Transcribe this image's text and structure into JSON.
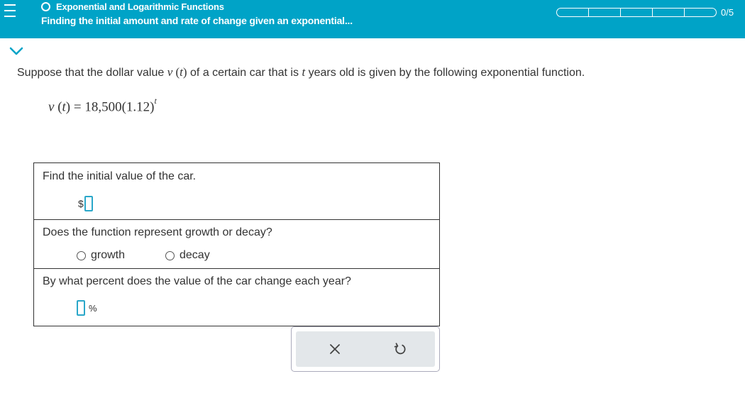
{
  "header": {
    "topic": "Exponential and Logarithmic Functions",
    "subtitle": "Finding the initial amount and rate of change given an exponential...",
    "progress": {
      "completed": 0,
      "total": 5,
      "label": "0/5"
    },
    "icons": {
      "menu": "hamburger-menu-icon",
      "topic_status": "hollow-circle-icon",
      "collapse": "chevron-down-icon"
    }
  },
  "problem": {
    "intro": "Suppose that the dollar value ",
    "func": "v",
    "paren_open": " (",
    "var": "t",
    "paren_close": ")",
    "mid": " of a certain car that is ",
    "var2": "t",
    "tail": " years old is given by the following exponential function.",
    "formula": {
      "lhs_func": "v",
      "lhs_open": " (",
      "lhs_var": "t",
      "lhs_close": ") = ",
      "coefficient": "18,500",
      "base": "(1.12)",
      "exponent": "t"
    }
  },
  "questions": [
    {
      "text": "Find the initial value of the car.",
      "prefix": "$",
      "value": ""
    },
    {
      "text": "Does the function represent growth or decay?",
      "options": [
        "growth",
        "decay"
      ],
      "selected": null
    },
    {
      "text": "By what percent does the value of the car change each year?",
      "suffix": "%",
      "value": ""
    }
  ],
  "actions": {
    "clear_icon": "x-icon",
    "undo_icon": "undo-icon"
  },
  "colors": {
    "header_bg": "#00a3c7",
    "input_border": "#2aa7c9",
    "action_bg": "#e3e7ea"
  }
}
